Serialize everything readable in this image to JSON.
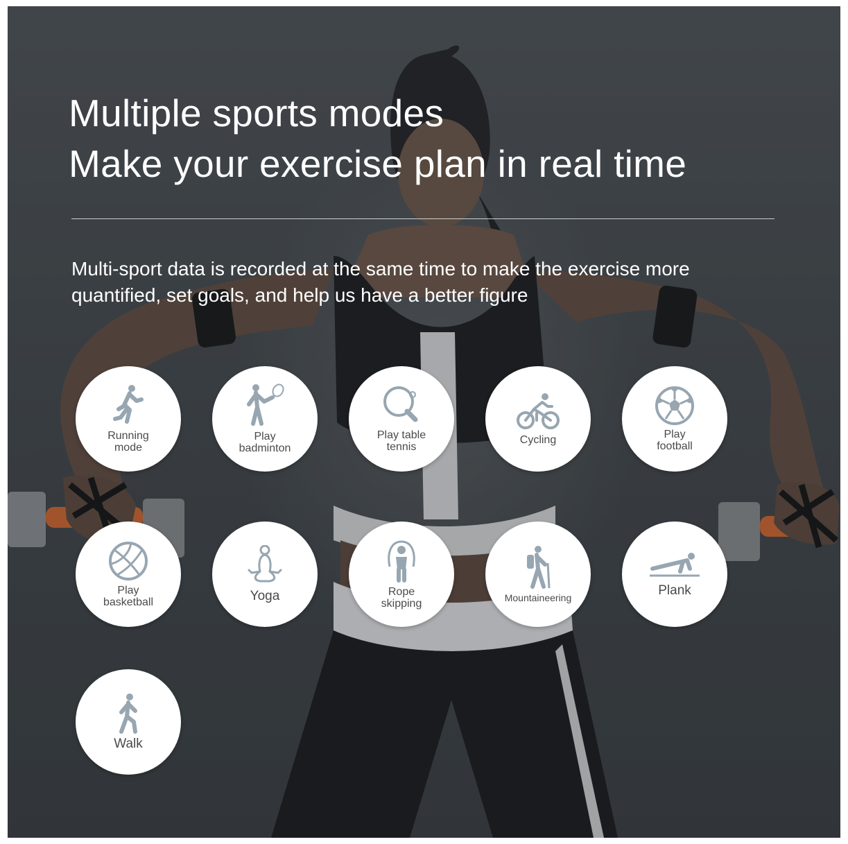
{
  "headline": {
    "line1": "Multiple sports modes",
    "line2": "Make your exercise plan in real time"
  },
  "description": "Multi-sport data is recorded at the same time to make the exercise more quantified, set goals, and help us have a better figure",
  "colors": {
    "icon": "#97a6b1",
    "label": "#4a4a4a",
    "circle": "#ffffff",
    "text": "#ffffff"
  },
  "sports_modes": [
    {
      "label": "Running\nmode",
      "icon": "running-icon"
    },
    {
      "label": "Play\nbadminton",
      "icon": "badminton-icon"
    },
    {
      "label": "Play table\ntennis",
      "icon": "table-tennis-icon"
    },
    {
      "label": "Cycling",
      "icon": "cycling-icon"
    },
    {
      "label": "Play\nfootball",
      "icon": "football-icon"
    },
    {
      "label": "Play\nbasketball",
      "icon": "basketball-icon"
    },
    {
      "label": "Yoga",
      "icon": "yoga-icon"
    },
    {
      "label": "Rope\nskipping",
      "icon": "rope-skipping-icon"
    },
    {
      "label": "Mountaineering",
      "icon": "mountaineering-icon"
    },
    {
      "label": "Plank",
      "icon": "plank-icon"
    },
    {
      "label": "Walk",
      "icon": "walk-icon"
    }
  ]
}
